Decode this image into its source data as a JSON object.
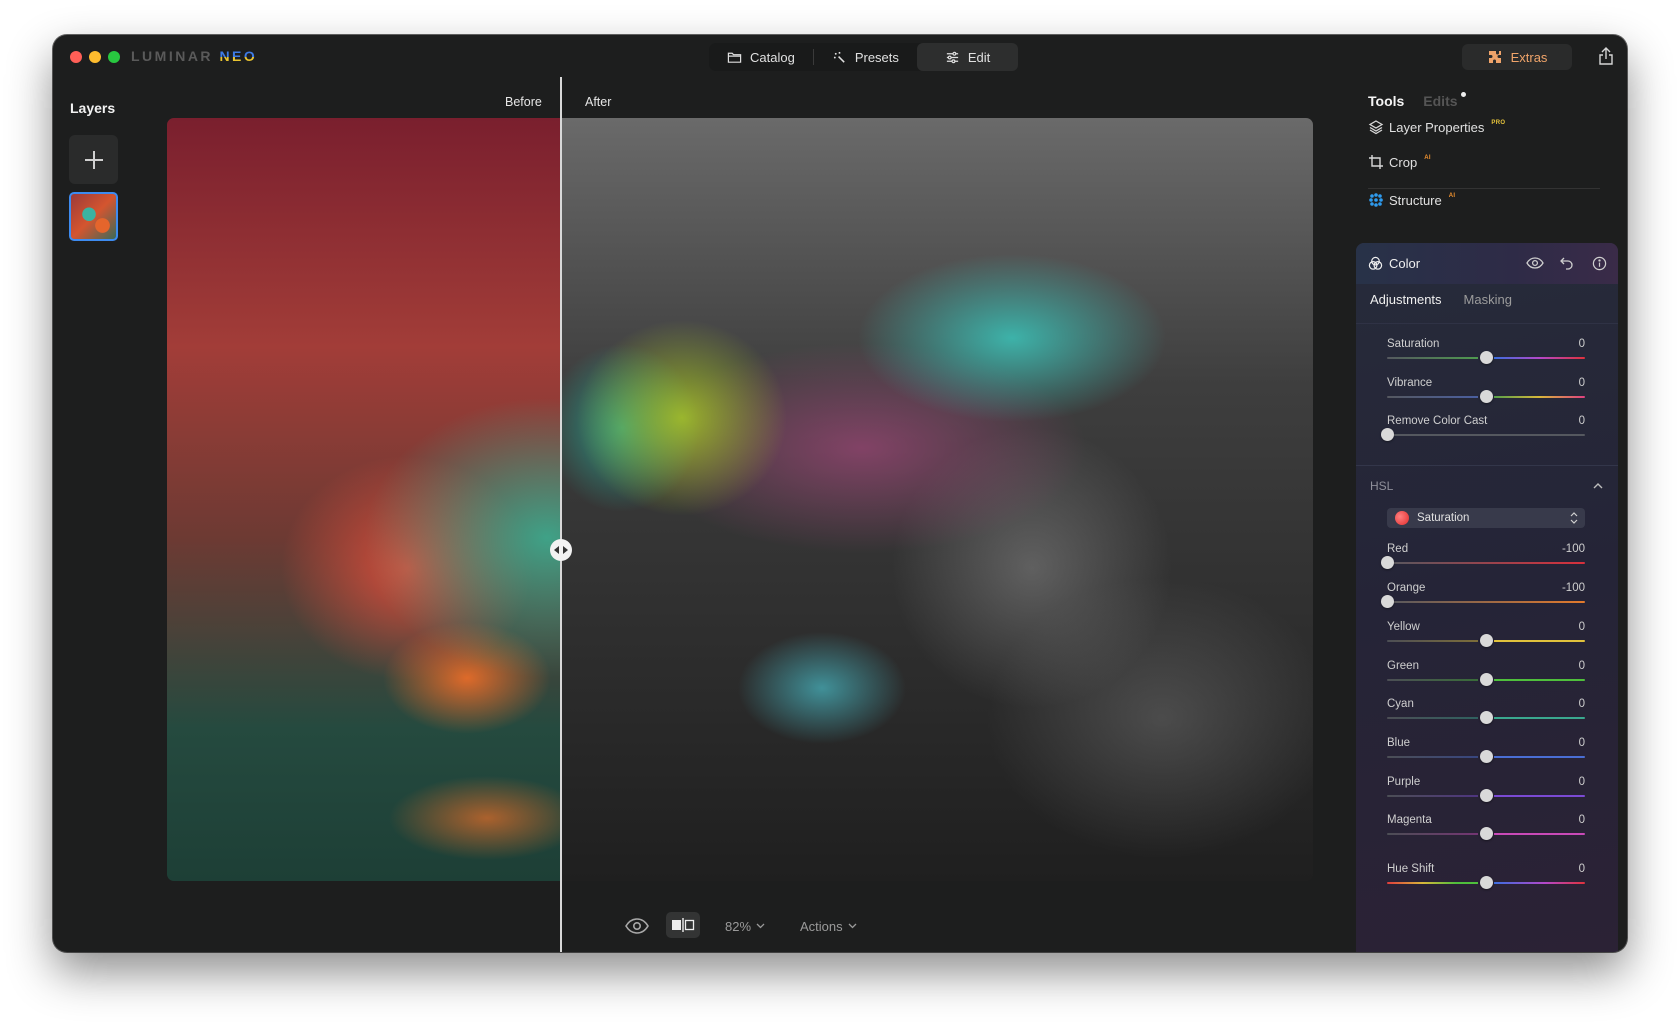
{
  "app": {
    "logo_part1": "LUMINAR",
    "logo_part2": "NEO"
  },
  "modes": [
    {
      "label": "Catalog",
      "icon": "folder-icon",
      "active": false
    },
    {
      "label": "Presets",
      "icon": "sparkle-wand-icon",
      "active": false
    },
    {
      "label": "Edit",
      "icon": "sliders-icon",
      "active": true
    }
  ],
  "extras": {
    "label": "Extras",
    "icon": "puzzle-icon",
    "color": "#f0a46a"
  },
  "share_icon": "share-icon",
  "layers": {
    "title": "Layers",
    "add_icon": "plus-icon"
  },
  "canvas": {
    "before_label": "Before",
    "after_label": "After",
    "split_handle_icon": "arrows-left-right-icon"
  },
  "bottom_bar": {
    "zoom": "82%",
    "actions": "Actions"
  },
  "right_panel": {
    "tabs": {
      "tools": "Tools",
      "edits": "Edits"
    },
    "tools": [
      {
        "label": "Layer Properties",
        "badge": "PRO",
        "icon": "layers-icon"
      },
      {
        "label": "Crop",
        "badge": "AI",
        "icon": "crop-icon"
      },
      {
        "label": "Structure",
        "badge": "AI",
        "icon": "structure-dots-icon"
      }
    ],
    "color_panel": {
      "title": "Color",
      "icon": "color-circles-icon",
      "tabs": {
        "adjustments": "Adjustments",
        "masking": "Masking"
      },
      "sliders": [
        {
          "label": "Saturation",
          "value": "0",
          "position": 0.5
        },
        {
          "label": "Vibrance",
          "value": "0",
          "position": 0.5
        },
        {
          "label": "Remove Color Cast",
          "value": "0",
          "position": 0.0
        }
      ],
      "hsl": {
        "title": "HSL",
        "mode": "Saturation",
        "sliders": [
          {
            "label": "Red",
            "value": "-100",
            "position": 0.0
          },
          {
            "label": "Orange",
            "value": "-100",
            "position": 0.0
          },
          {
            "label": "Yellow",
            "value": "0",
            "position": 0.5
          },
          {
            "label": "Green",
            "value": "0",
            "position": 0.5
          },
          {
            "label": "Cyan",
            "value": "0",
            "position": 0.5
          },
          {
            "label": "Blue",
            "value": "0",
            "position": 0.5
          },
          {
            "label": "Purple",
            "value": "0",
            "position": 0.5
          },
          {
            "label": "Magenta",
            "value": "0",
            "position": 0.5
          }
        ],
        "hue_shift": {
          "label": "Hue Shift",
          "value": "0",
          "position": 0.5
        }
      }
    }
  },
  "colors": {
    "accent_blue": "#3d8bf0",
    "pro_badge": "#e8c53b",
    "ai_badge": "#f0922f"
  }
}
